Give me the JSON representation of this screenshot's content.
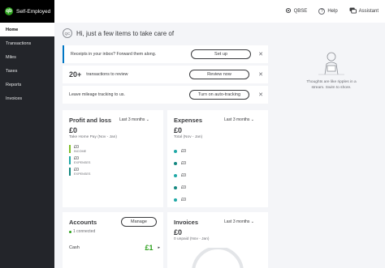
{
  "app": {
    "name": "Self-Employed",
    "logo_text": "qb"
  },
  "topnav": {
    "company": "QBSE",
    "help": "Help",
    "assistant": "Assistant"
  },
  "sidebar": {
    "items": [
      {
        "label": "Home",
        "active": true
      },
      {
        "label": "Transactions"
      },
      {
        "label": "Miles"
      },
      {
        "label": "Taxes"
      },
      {
        "label": "Reports"
      },
      {
        "label": "Invoices"
      }
    ]
  },
  "greeting": {
    "initials": "QC",
    "text": "Hi, just a few items to take care of"
  },
  "tasks": [
    {
      "text": "Receipts in your inbox? Forward them along.",
      "button": "Set up"
    },
    {
      "count": "20+",
      "text": "transactions to review",
      "button": "Review now"
    },
    {
      "text": "Leave mileage tracking to us.",
      "button": "Turn on auto-tracking"
    }
  ],
  "illustration": {
    "caption_line1": "Thoughts are like ripples in a",
    "caption_line2": "stream. Swim to shore."
  },
  "profit_loss": {
    "title": "Profit and loss",
    "period": "Last 3 months",
    "amount": "£0",
    "sub": "Take Home Pay (Nov - Jan)",
    "legend": [
      {
        "value": "£0",
        "label": "INCOME",
        "color": "#7fbf2a"
      },
      {
        "value": "£0",
        "label": "EXPENSES",
        "color": "#1fa8a6"
      },
      {
        "value": "£0",
        "label": "EXPENSES",
        "color": "#13877f"
      }
    ]
  },
  "expenses": {
    "title": "Expenses",
    "period": "Last 3 months",
    "amount": "£0",
    "sub": "Total (Nov - Jan)",
    "rows": [
      {
        "value": "£0",
        "color": "#1fa8a6"
      },
      {
        "value": "£0",
        "color": "#13877f"
      },
      {
        "value": "£0",
        "color": "#1fa8a6"
      },
      {
        "value": "£0",
        "color": "#13877f"
      },
      {
        "value": "£0",
        "color": "#1fa8a6"
      }
    ]
  },
  "accounts": {
    "title": "Accounts",
    "manage": "Manage",
    "connected": "1 connected",
    "cash_label": "Cash",
    "cash_value": "£1",
    "cash_arrow": "▸"
  },
  "invoices": {
    "title": "Invoices",
    "period": "Last 3 months",
    "amount": "£0",
    "sub": "0 unpaid (Nov - Jan)"
  },
  "colors": {
    "accent": "#0077c5",
    "brand": "#2ca01c",
    "sidebar": "#23252a"
  },
  "icons": {
    "help": "help-icon",
    "settings": "gear-icon",
    "assistant": "chat-icon",
    "close": "close-icon",
    "chevron": "chevron-down-icon"
  }
}
